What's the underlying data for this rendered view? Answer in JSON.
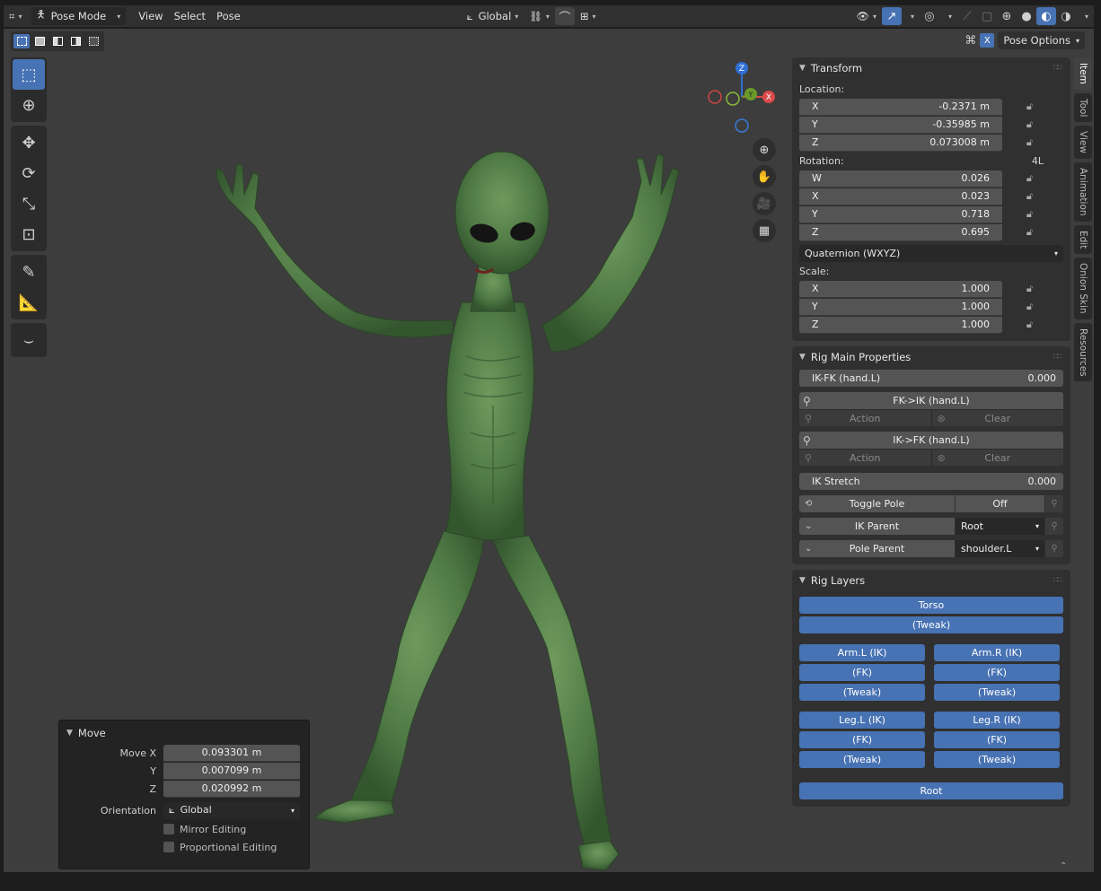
{
  "header": {
    "mode_label": "Pose Mode",
    "menus": [
      "View",
      "Select",
      "Pose"
    ],
    "orientation_label": "Global"
  },
  "tool_options": {
    "pose_options_label": "Pose Options",
    "x_mirror_label": "X"
  },
  "gizmo": {
    "z": "Z",
    "y": "Y",
    "x": "X"
  },
  "sidebar_tabs": [
    "Item",
    "Tool",
    "View",
    "Animation",
    "Edit",
    "Onion Skin",
    "Resources"
  ],
  "transform": {
    "title": "Transform",
    "location_label": "Location:",
    "location": [
      {
        "axis": "X",
        "value": "-0.2371 m"
      },
      {
        "axis": "Y",
        "value": "-0.35985 m"
      },
      {
        "axis": "Z",
        "value": "0.073008 m"
      }
    ],
    "rotation_label": "Rotation:",
    "rotation_badge": "4L",
    "rotation": [
      {
        "axis": "W",
        "value": "0.026"
      },
      {
        "axis": "X",
        "value": "0.023"
      },
      {
        "axis": "Y",
        "value": "0.718"
      },
      {
        "axis": "Z",
        "value": "0.695"
      }
    ],
    "rotation_mode": "Quaternion (WXYZ)",
    "scale_label": "Scale:",
    "scale": [
      {
        "axis": "X",
        "value": "1.000"
      },
      {
        "axis": "Y",
        "value": "1.000"
      },
      {
        "axis": "Z",
        "value": "1.000"
      }
    ]
  },
  "rig_main": {
    "title": "Rig Main Properties",
    "ikfk_label": "IK-FK (hand.L)",
    "ikfk_value": "0.000",
    "fk_to_ik": "FK->IK (hand.L)",
    "ik_to_fk": "IK->FK (hand.L)",
    "action_label": "Action",
    "clear_label": "Clear",
    "ik_stretch_label": "IK Stretch",
    "ik_stretch_value": "0.000",
    "toggle_pole_label": "Toggle Pole",
    "toggle_pole_value": "Off",
    "ik_parent_label": "IK Parent",
    "ik_parent_value": "Root",
    "pole_parent_label": "Pole Parent",
    "pole_parent_value": "shoulder.L"
  },
  "rig_layers": {
    "title": "Rig Layers",
    "torso": "Torso",
    "torso_tweak": "(Tweak)",
    "arms": [
      [
        "Arm.L (IK)",
        "Arm.R (IK)"
      ],
      [
        "(FK)",
        "(FK)"
      ],
      [
        "(Tweak)",
        "(Tweak)"
      ]
    ],
    "legs": [
      [
        "Leg.L (IK)",
        "Leg.R (IK)"
      ],
      [
        "(FK)",
        "(FK)"
      ],
      [
        "(Tweak)",
        "(Tweak)"
      ]
    ],
    "root": "Root"
  },
  "move_panel": {
    "title": "Move",
    "move_x_label": "Move X",
    "move_x": "0.093301 m",
    "y_label": "Y",
    "y": "0.007099 m",
    "z_label": "Z",
    "z": "0.020992 m",
    "orientation_label": "Orientation",
    "orientation_value": "Global",
    "mirror_label": "Mirror Editing",
    "proportional_label": "Proportional Editing"
  }
}
